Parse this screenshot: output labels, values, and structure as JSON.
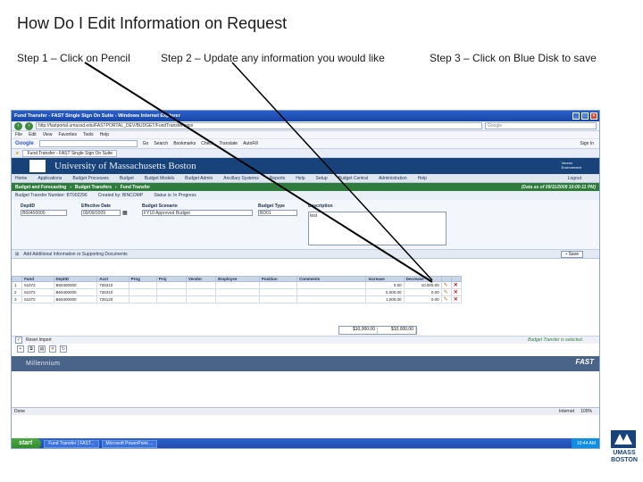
{
  "slide": {
    "title": "How Do I Edit Information on Request",
    "step1": "Step 1 – Click on Pencil",
    "step2": "Step 2 – Update any information you would like",
    "step3": "Step 3 – Click on Blue Disk to save"
  },
  "browser": {
    "window_title": "Fund Transfer - FAST Single Sign On Suite - Windows Internet Explorer",
    "url": "http://fastportal.umassd.edu/FASTPORTAL_DEV/BUDGET/FundTransfer.aspx",
    "search_placeholder": "Google",
    "menu": [
      "File",
      "Edit",
      "View",
      "Favorites",
      "Tools",
      "Help"
    ],
    "google_label": "Google",
    "google_tools": [
      "Go",
      "Search",
      "Bookmarks",
      "Check",
      "Translate",
      "AutoFill",
      "Sign In"
    ],
    "tab": "Fund Transfer - FAST Single Sign On Suite"
  },
  "app": {
    "banner_title": "University of Massachusetts Boston",
    "banner_right": [
      "Vendor",
      "Environment",
      "Logout"
    ],
    "menu": [
      "Home",
      "Applications",
      "Budget Processes",
      "Budget",
      "Budget Models",
      "Budget Admin",
      "Ancillary Systems",
      "Reports",
      "Help",
      "Setup",
      "Budget Central",
      "Administration",
      "Help"
    ],
    "breadcrumb": [
      "Budget and Forecasting",
      "Budget Transfers",
      "Fund Transfer"
    ],
    "breadcrumb_right": "(Data as of 09/11/2009 10:00:11 PM)",
    "header": {
      "transfer_number": "Budget Transfer Number: BT002296",
      "created_by": "Created by: BINCOMP",
      "status": "Status is: In Progress"
    },
    "form": {
      "deptid_label": "DeptID",
      "deptid_value": "B60400000",
      "effective_label": "Effective Date",
      "effective_value": "09/09/2009",
      "scenario_label": "Budget Scenario",
      "scenario_value": "FY10 Approved Budget",
      "type_label": "Budget Type",
      "type_value": "BD01",
      "description_label": "Description",
      "description_value": "test"
    },
    "table_toolbar": "Add Additional Information or Supporting Documents",
    "save_label": "Save",
    "columns": [
      "",
      "Fund",
      "DeptID",
      "Acct",
      "Prog",
      "Proj",
      "Vendor",
      "Employee",
      "Position",
      "Comments",
      "Increase",
      "Decrease",
      "",
      ""
    ],
    "rows": [
      {
        "n": "1",
        "fund": "51072",
        "dept": "B60400000",
        "acct": "726310",
        "inc": "0.00",
        "dec": "10,000.00"
      },
      {
        "n": "2",
        "fund": "51072",
        "dept": "B60400000",
        "acct": "726310",
        "inc": "5,000.00",
        "dec": "0.00"
      },
      {
        "n": "3",
        "fund": "51072",
        "dept": "B60400000",
        "acct": "726120",
        "inc": "1,000.00",
        "dec": "0.00"
      }
    ],
    "totals": [
      "$10,000.00",
      "$10,000.00"
    ],
    "ok_row_label": "Reset Import",
    "ok_message": "Budget Transfer is selected.",
    "footer_left": "Millennium",
    "footer_right": "FAST"
  },
  "status": {
    "left": "Done",
    "zone": "Internet",
    "zoom": "100%"
  },
  "taskbar": {
    "start": "start",
    "items": [
      "Fund Transfer | FAST...",
      "Microsoft PowerPoint ..."
    ],
    "clock": "10:44 AM"
  },
  "brand": {
    "line1": "UMASS",
    "line2": "BOSTON",
    "color": "#17437a"
  }
}
